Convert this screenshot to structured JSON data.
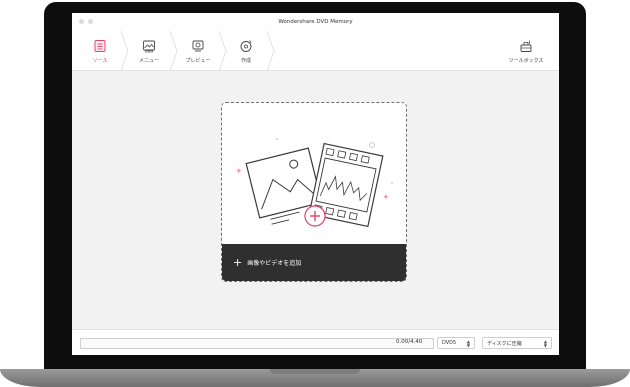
{
  "window": {
    "title": "Wondershare DVD Memory"
  },
  "steps": [
    {
      "label": "ソース",
      "icon": "source-icon",
      "active": true
    },
    {
      "label": "メニュー",
      "icon": "menu-template-icon",
      "active": false
    },
    {
      "label": "プレビュー",
      "icon": "preview-icon",
      "active": false
    },
    {
      "label": "作成",
      "icon": "burn-disc-icon",
      "active": false
    }
  ],
  "toolbox": {
    "label": "ツールボックス",
    "icon": "toolbox-icon"
  },
  "dropzone": {
    "add_label": "画像やビデオを追加",
    "plus_glyph": "+"
  },
  "bottom": {
    "capacity_text": "0.00/4.40",
    "disc_type": "DVD5",
    "output": "ディスクに圧縮"
  },
  "colors": {
    "accent": "#e0436a",
    "bar_dark": "#2f2f2f"
  }
}
